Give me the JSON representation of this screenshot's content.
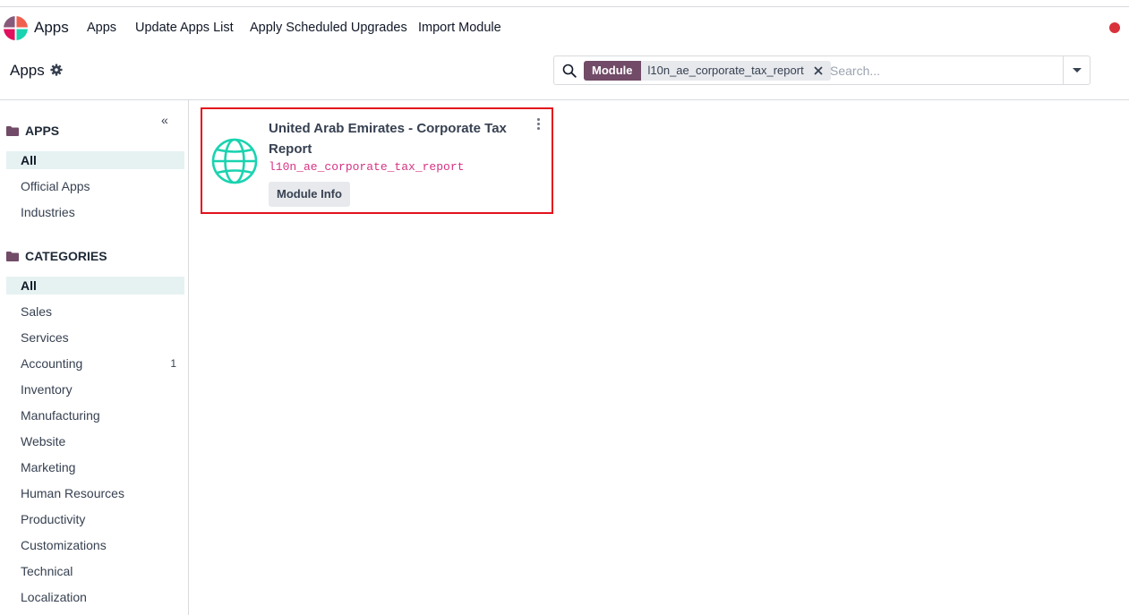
{
  "navbar": {
    "brand": "Apps",
    "items": [
      {
        "label": "Apps"
      },
      {
        "label": "Update Apps List"
      },
      {
        "label": "Apply Scheduled Upgrades"
      },
      {
        "label": "Import Module"
      }
    ]
  },
  "control_panel": {
    "title": "Apps",
    "search": {
      "facet_label": "Module",
      "facet_value": "l10n_ae_corporate_tax_report",
      "placeholder": "Search..."
    }
  },
  "sidebar": {
    "apps_heading": "APPS",
    "apps_items": [
      {
        "label": "All",
        "active": true
      },
      {
        "label": "Official Apps"
      },
      {
        "label": "Industries"
      }
    ],
    "categories_heading": "CATEGORIES",
    "category_items": [
      {
        "label": "All",
        "active": true
      },
      {
        "label": "Sales"
      },
      {
        "label": "Services"
      },
      {
        "label": "Accounting",
        "count": "1"
      },
      {
        "label": "Inventory"
      },
      {
        "label": "Manufacturing"
      },
      {
        "label": "Website"
      },
      {
        "label": "Marketing"
      },
      {
        "label": "Human Resources"
      },
      {
        "label": "Productivity"
      },
      {
        "label": "Customizations"
      },
      {
        "label": "Technical"
      },
      {
        "label": "Localization"
      }
    ]
  },
  "card": {
    "title": "United Arab Emirates - Corporate Tax Report",
    "technical_name": "l10n_ae_corporate_tax_report",
    "button": "Module Info",
    "icon": "globe-icon"
  },
  "colors": {
    "brand": "#714b67",
    "highlight_border": "#e3111c",
    "globe": "#1ad3b0",
    "technical_name": "#d63384",
    "active_bg": "#e6f2f2"
  }
}
